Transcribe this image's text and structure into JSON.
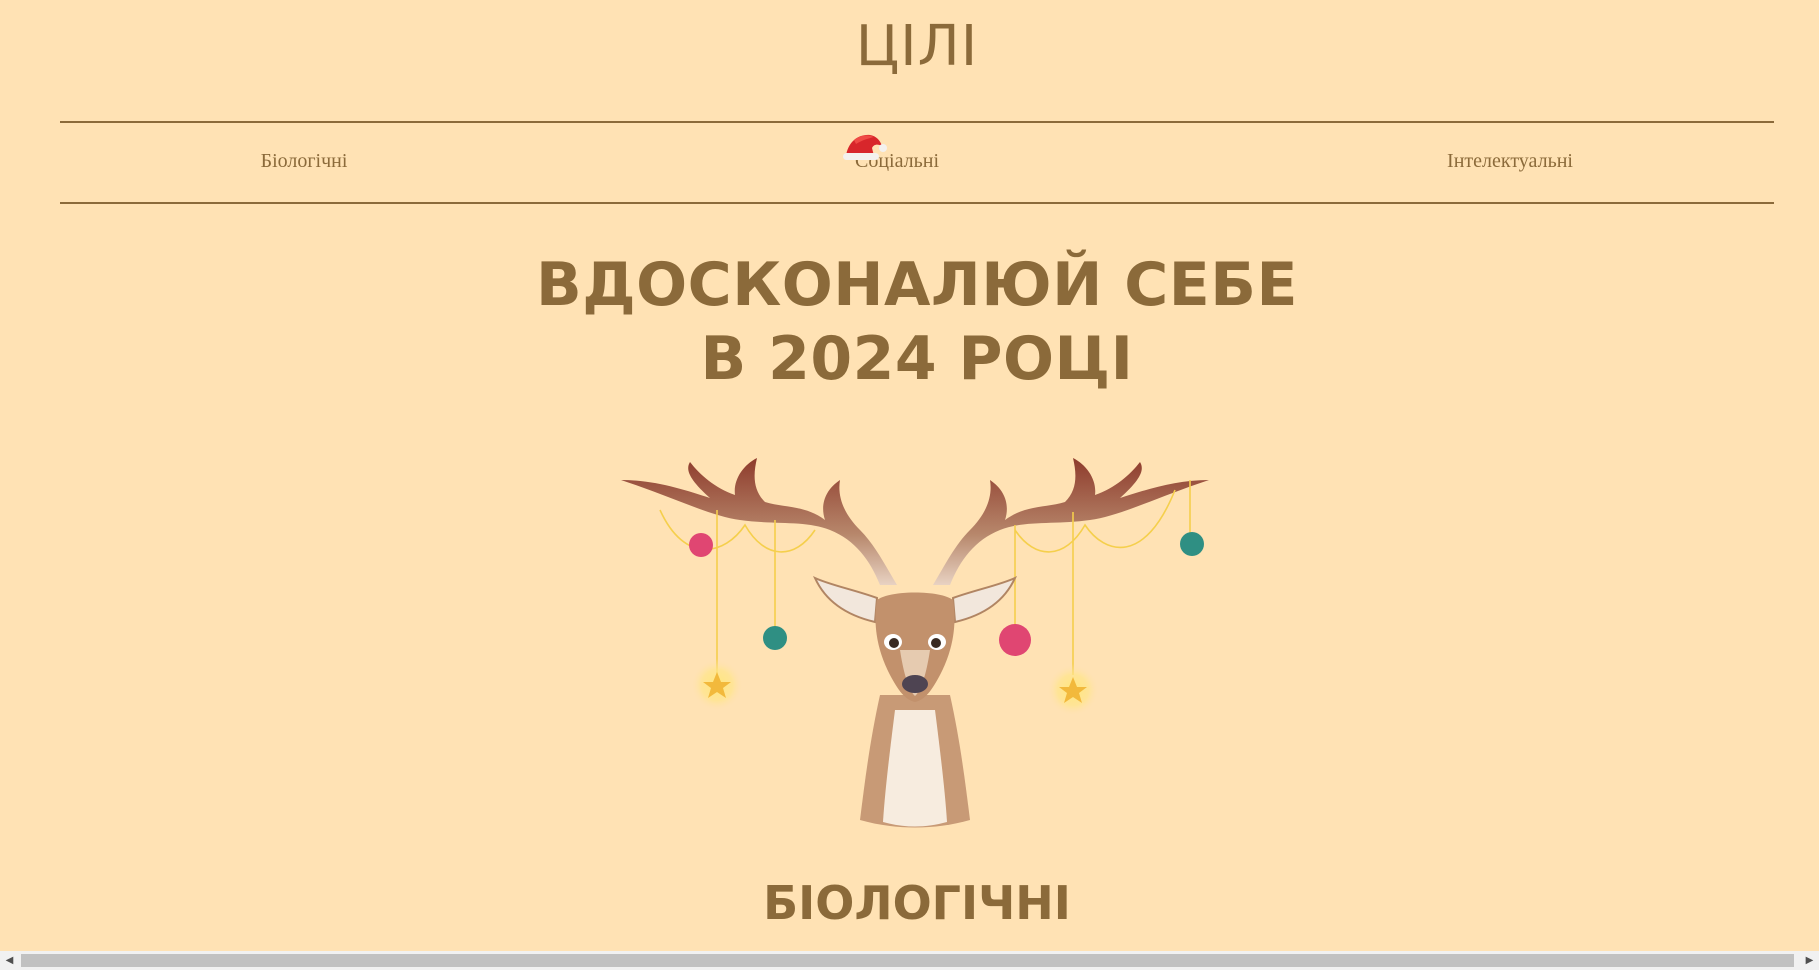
{
  "header": {
    "title": "ЦІЛІ"
  },
  "nav": {
    "items": [
      {
        "label": "Біологічні"
      },
      {
        "label": "Соціальні"
      },
      {
        "label": "Інтелектуальні"
      }
    ]
  },
  "hero": {
    "line1": "ВДОСКОНАЛЮЙ СЕБЕ",
    "line2": "В 2024 РОЦІ"
  },
  "section": {
    "title": "БІОЛОГІЧНІ"
  },
  "icons": {
    "hat": "santa-hat-icon",
    "illustration": "deer-with-ornaments-illustration",
    "scroll_left": "chevron-left-icon",
    "scroll_right": "chevron-right-icon"
  },
  "colors": {
    "background": "#ffe2b4",
    "accent": "#8b6a3a"
  }
}
